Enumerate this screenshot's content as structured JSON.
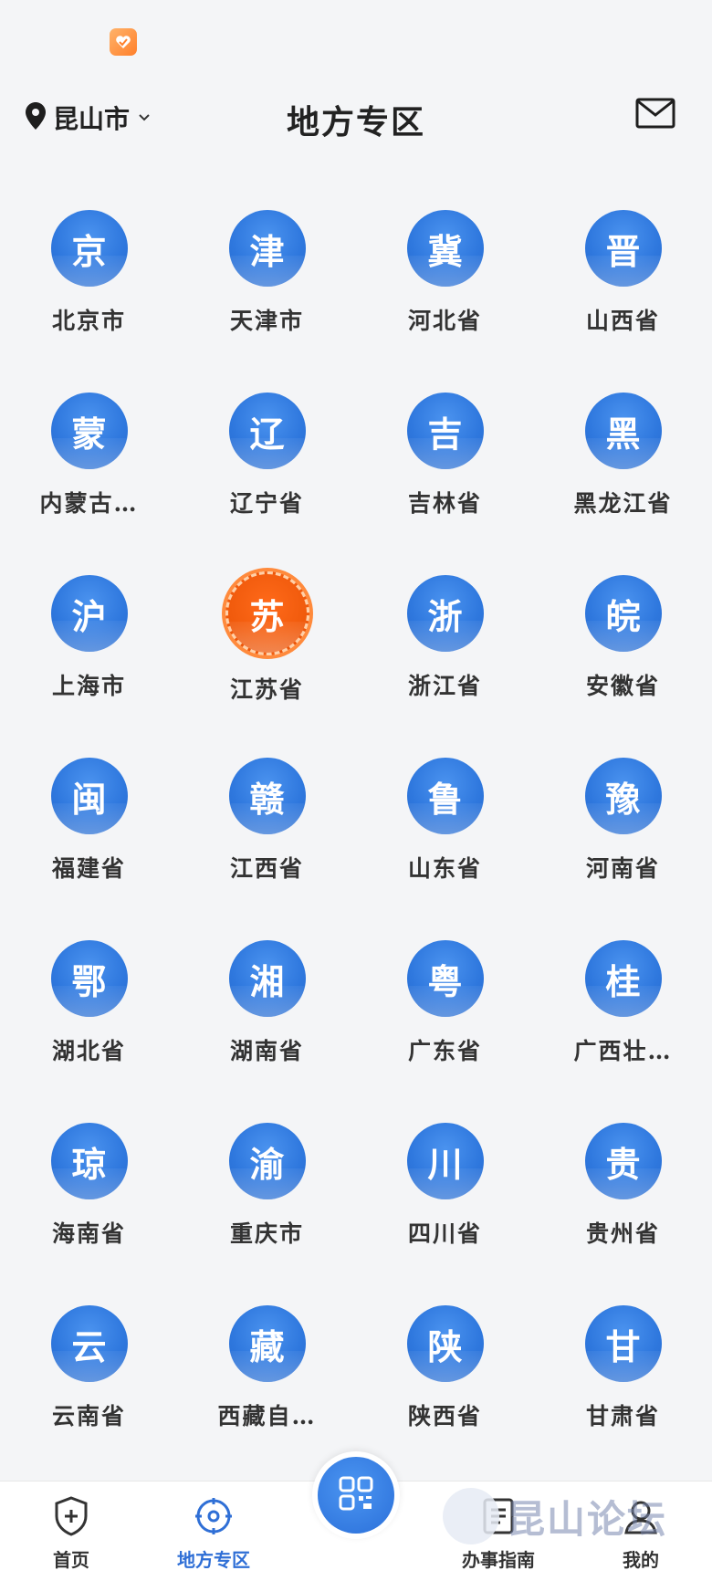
{
  "header": {
    "location": "昆山市",
    "title": "地方专区"
  },
  "regions": [
    {
      "glyph": "京",
      "label": "北京市"
    },
    {
      "glyph": "津",
      "label": "天津市"
    },
    {
      "glyph": "冀",
      "label": "河北省"
    },
    {
      "glyph": "晋",
      "label": "山西省"
    },
    {
      "glyph": "蒙",
      "label": "内蒙古…"
    },
    {
      "glyph": "辽",
      "label": "辽宁省"
    },
    {
      "glyph": "吉",
      "label": "吉林省"
    },
    {
      "glyph": "黑",
      "label": "黑龙江省"
    },
    {
      "glyph": "沪",
      "label": "上海市"
    },
    {
      "glyph": "苏",
      "label": "江苏省",
      "highlight": true
    },
    {
      "glyph": "浙",
      "label": "浙江省"
    },
    {
      "glyph": "皖",
      "label": "安徽省"
    },
    {
      "glyph": "闽",
      "label": "福建省"
    },
    {
      "glyph": "赣",
      "label": "江西省"
    },
    {
      "glyph": "鲁",
      "label": "山东省"
    },
    {
      "glyph": "豫",
      "label": "河南省"
    },
    {
      "glyph": "鄂",
      "label": "湖北省"
    },
    {
      "glyph": "湘",
      "label": "湖南省"
    },
    {
      "glyph": "粤",
      "label": "广东省"
    },
    {
      "glyph": "桂",
      "label": "广西壮…"
    },
    {
      "glyph": "琼",
      "label": "海南省"
    },
    {
      "glyph": "渝",
      "label": "重庆市"
    },
    {
      "glyph": "川",
      "label": "四川省"
    },
    {
      "glyph": "贵",
      "label": "贵州省"
    },
    {
      "glyph": "云",
      "label": "云南省"
    },
    {
      "glyph": "藏",
      "label": "西藏自…"
    },
    {
      "glyph": "陕",
      "label": "陕西省"
    },
    {
      "glyph": "甘",
      "label": "甘肃省"
    }
  ],
  "tabbar": {
    "home": "首页",
    "local": "地方专区",
    "guide": "办事指南",
    "mine": "我的"
  },
  "watermark": "昆山论坛",
  "colors": {
    "accent_blue": "#2f78de",
    "highlight_orange": "#f05a0c",
    "active_tab": "#2f6fd6"
  },
  "icons": {
    "location": "location-pin-icon",
    "dropdown": "chevron-down-icon",
    "mail": "mail-icon",
    "home": "shield-plus-icon",
    "local": "target-icon",
    "scan": "qr-scan-icon",
    "guide": "document-icon",
    "mine": "user-icon"
  }
}
